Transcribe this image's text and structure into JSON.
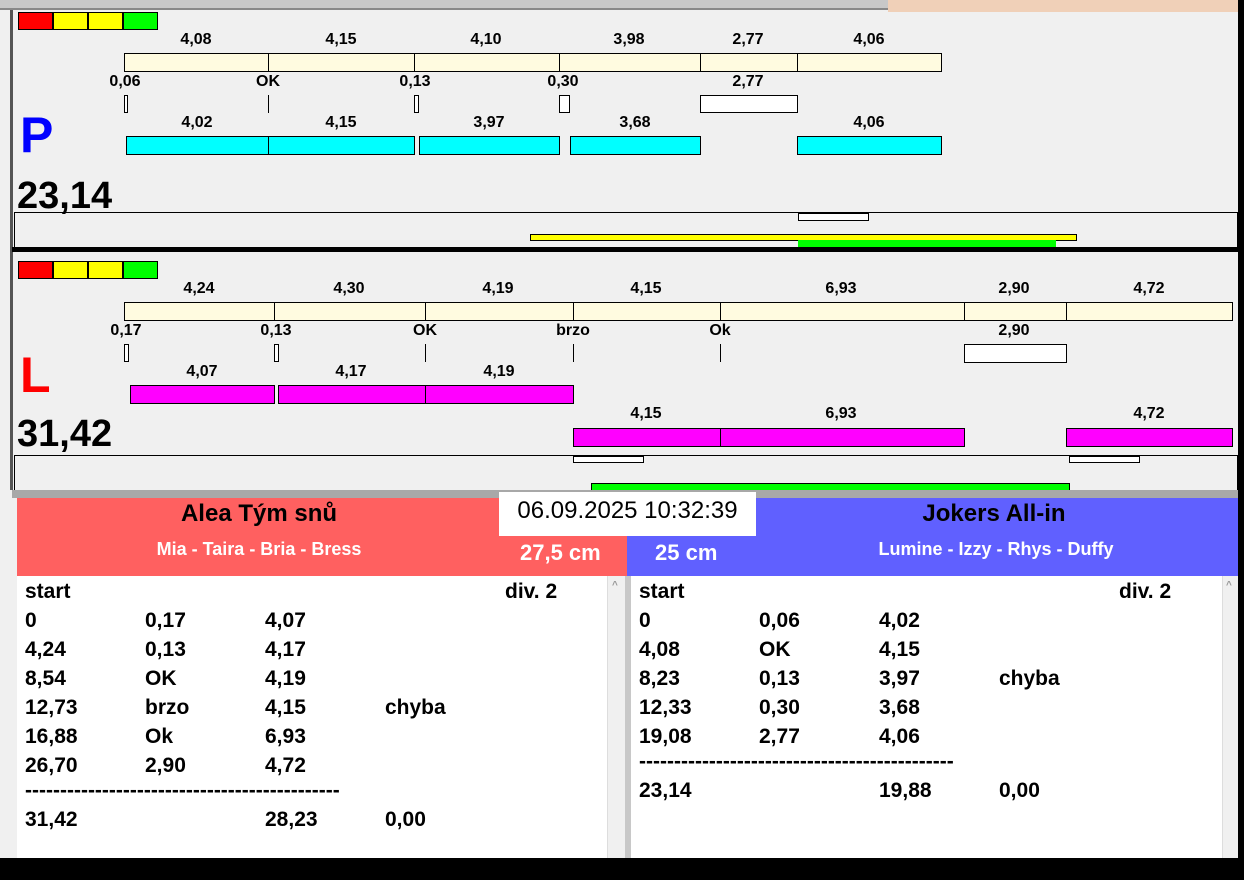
{
  "lane_p": {
    "letter": "P",
    "total": "23,14",
    "times": [
      "4,08",
      "4,15",
      "4,10",
      "3,98",
      "2,77",
      "4,06"
    ],
    "reactions": [
      "0,06",
      "OK",
      "0,13",
      "0,30",
      "2,77"
    ],
    "splits": [
      "4,02",
      "4,15",
      "3,97",
      "3,68",
      "4,06"
    ]
  },
  "lane_l": {
    "letter": "L",
    "total": "31,42",
    "times": [
      "4,24",
      "4,30",
      "4,19",
      "4,15",
      "6,93",
      "2,90",
      "4,72"
    ],
    "reactions": [
      "0,17",
      "0,13",
      "OK",
      "brzo",
      "Ok",
      "2,90"
    ],
    "splits_top": [
      "4,07",
      "4,17",
      "4,19"
    ],
    "splits_bottom": [
      "4,15",
      "6,93",
      "4,72"
    ]
  },
  "datetime": "06.09.2025 10:32:39",
  "team_left": {
    "name": "Alea Tým snů",
    "players": "Mia - Taira - Bria - Bress",
    "distance": "27,5 cm",
    "color": "#ff6060",
    "list": {
      "header": "start",
      "division": "div.  2",
      "rows": [
        [
          "0",
          "0,17",
          "4,07",
          ""
        ],
        [
          "4,24",
          "0,13",
          "4,17",
          ""
        ],
        [
          "8,54",
          "OK",
          "4,19",
          ""
        ],
        [
          "12,73",
          "brzo",
          "4,15",
          "chyba"
        ],
        [
          "16,88",
          "Ok",
          "6,93",
          ""
        ],
        [
          "26,70",
          "2,90",
          "4,72",
          ""
        ]
      ],
      "separator": "---------------------------------------------",
      "totals": [
        "31,42",
        "",
        "28,23",
        "0,00"
      ]
    }
  },
  "team_right": {
    "name": "Jokers All-in",
    "players": "Lumine - Izzy - Rhys - Duffy",
    "distance": "25 cm",
    "color": "#6060ff",
    "list": {
      "header": "start",
      "division": "div.  2",
      "rows": [
        [
          "0",
          "0,06",
          "4,02",
          ""
        ],
        [
          "4,08",
          "OK",
          "4,15",
          ""
        ],
        [
          "8,23",
          "0,13",
          "3,97",
          "chyba"
        ],
        [
          "12,33",
          "0,30",
          "3,68",
          ""
        ],
        [
          "19,08",
          "2,77",
          "4,06",
          ""
        ]
      ],
      "separator": "---------------------------------------------",
      "totals": [
        "23,14",
        "",
        "19,88",
        "0,00"
      ]
    }
  }
}
